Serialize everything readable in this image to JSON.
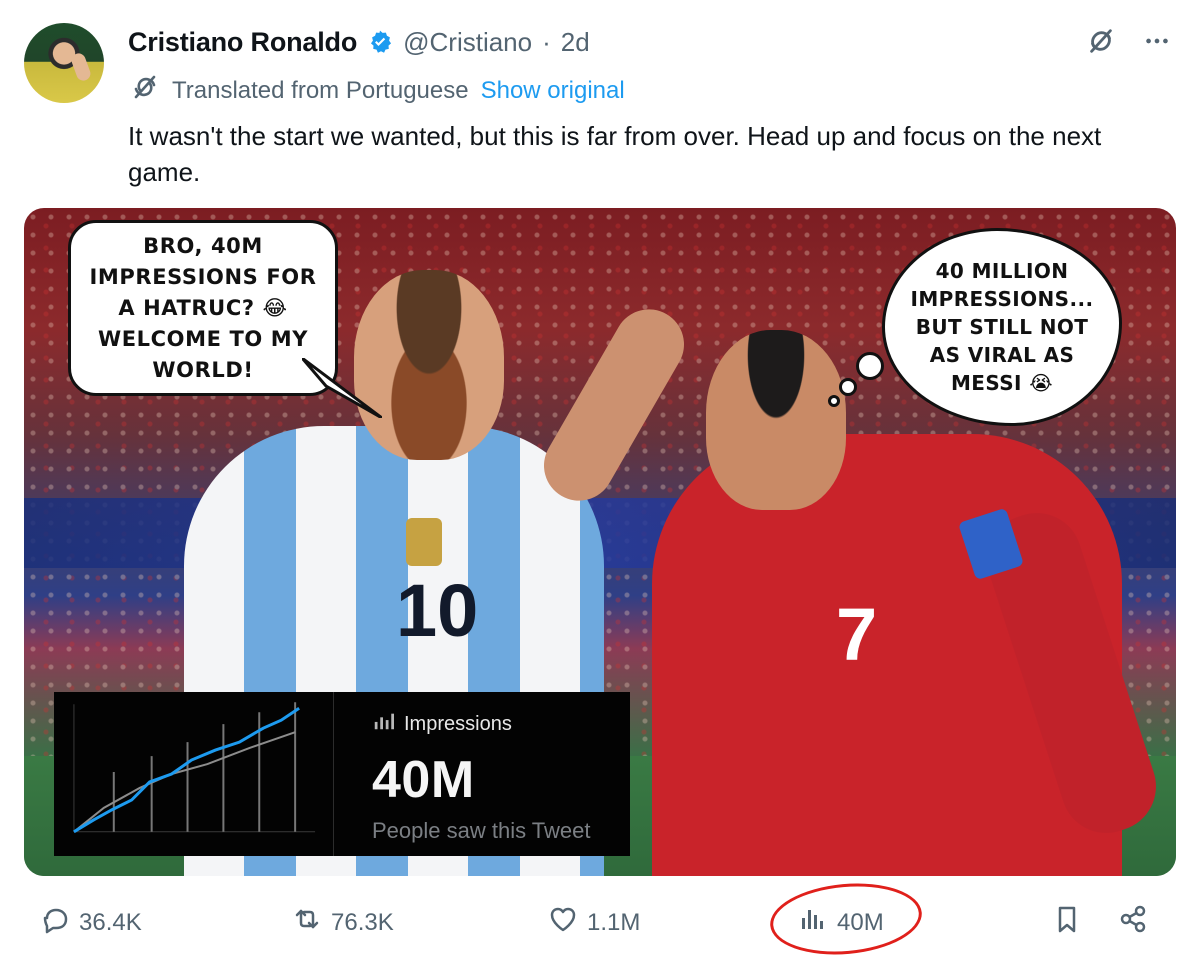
{
  "tweet": {
    "author": {
      "name": "Cristiano Ronaldo",
      "handle": "@Cristiano",
      "separator": "·",
      "time": "2d"
    },
    "translation": {
      "label": "Translated from Portuguese",
      "action": "Show original"
    },
    "text": "It wasn't the start we wanted, but this is far from over. Head up and focus on the next game.",
    "media": {
      "speech_bubble": "Bro, 40M impressions for a hatruc? 😂 welcome to my world!",
      "thought_bubble": "40 million impressions... but still not as viral as Messi 😭",
      "messi_number": "10",
      "ronaldo_number": "7",
      "impressions_card": {
        "title": "Impressions",
        "value": "40M",
        "caption": "People saw this Tweet"
      }
    },
    "actions": {
      "replies": "36.4K",
      "reposts": "76.3K",
      "likes": "1.1M",
      "views": "40M"
    }
  },
  "icons": {
    "verified": "verified-badge-icon",
    "grok": "grok-icon",
    "more": "more-icon",
    "translate": "translate-icon",
    "reply": "reply-icon",
    "repost": "repost-icon",
    "like": "like-icon",
    "views": "views-icon",
    "bookmark": "bookmark-icon",
    "share": "share-icon"
  },
  "colors": {
    "accent": "#1d9bf0",
    "muted": "#536471",
    "annotation": "#e0201b"
  }
}
